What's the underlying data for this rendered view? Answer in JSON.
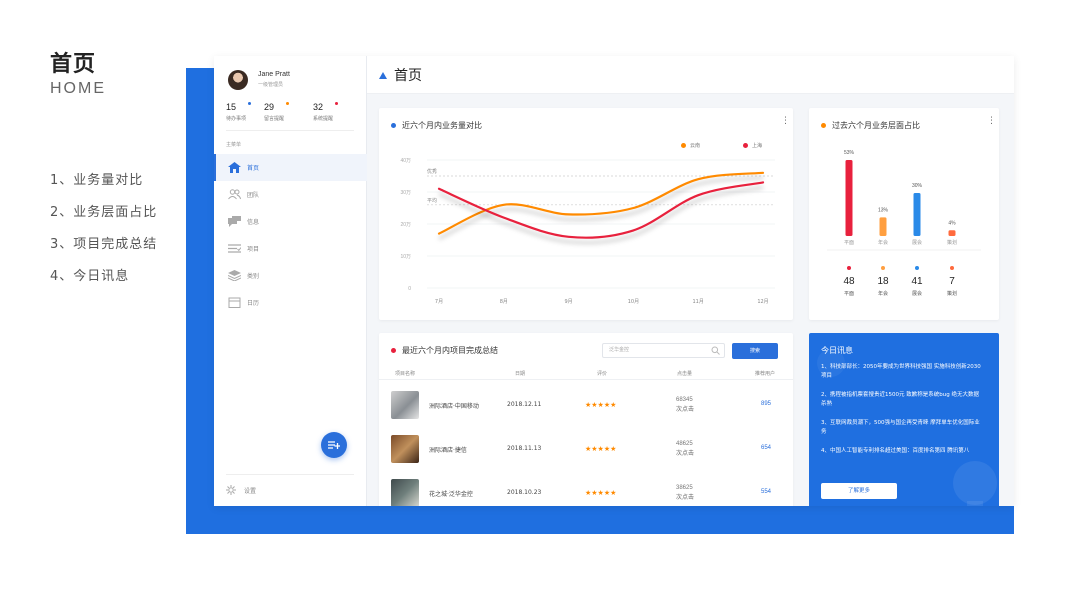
{
  "slide": {
    "title": "首页",
    "subtitle": "HOME",
    "outline": [
      "1、业务量对比",
      "2、业务层面占比",
      "3、项目完成总结",
      "4、今日讯息"
    ]
  },
  "user": {
    "name": "Jane Pratt",
    "role": "一级管理员"
  },
  "stats": [
    {
      "value": "15",
      "label": "待办事项",
      "color": "#2a6fdb"
    },
    {
      "value": "29",
      "label": "留言提醒",
      "color": "#ff8a00"
    },
    {
      "value": "32",
      "label": "系统提醒",
      "color": "#e8213d"
    }
  ],
  "menu": {
    "heading": "主菜单",
    "items": [
      {
        "label": "首页",
        "icon": "home-icon",
        "active": true
      },
      {
        "label": "团队",
        "icon": "team-icon"
      },
      {
        "label": "信息",
        "icon": "message-icon"
      },
      {
        "label": "项目",
        "icon": "project-icon"
      },
      {
        "label": "类别",
        "icon": "layers-icon"
      },
      {
        "label": "日历",
        "icon": "calendar-icon"
      }
    ],
    "settings_label": "设置"
  },
  "topbar": {
    "title": "首页"
  },
  "line_card": {
    "title": "近六个月内业务量对比",
    "legend": [
      "云南",
      "上海"
    ]
  },
  "bar_card": {
    "title": "过去六个月业务层面占比"
  },
  "table_card": {
    "title": "最近六个月内项目完成总结",
    "search_placeholder": "泛华金控",
    "search_button": "搜索",
    "headers": [
      "项目名称",
      "日期",
      "评价",
      "点击量",
      "推荐用户"
    ],
    "rows": [
      {
        "name": "洲际酒店·中国移动",
        "date": "2018.12.11",
        "stars": "★★★★★",
        "clicks": "68345",
        "clicks_label": "次点击",
        "users": "895"
      },
      {
        "name": "洲际酒店·捷信",
        "date": "2018.11.13",
        "stars": "★★★★★",
        "clicks": "48625",
        "clicks_label": "次点击",
        "users": "654"
      },
      {
        "name": "花之城·泛华金控",
        "date": "2018.10.23",
        "stars": "★★★★★",
        "clicks": "38625",
        "clicks_label": "次点击",
        "users": "554"
      }
    ]
  },
  "news": {
    "title": "今日讯息",
    "items": [
      "1、科技部部长：2050年要成为世界科技强国 实施科技创新2030项目",
      "2、携程被指机票套搜贵近1500元 致歉称是系统bug 绝无大数据杀熟",
      "3、互联网裁员潮下，500强与国企再受青睐 摩拜单车优化国际业务",
      "4、中国人工智能专利排名超过美国：百度排名第四 腾讯第八"
    ],
    "button": "了解更多"
  },
  "colors": {
    "blue": "#2a6fdb",
    "orange": "#ff8a00",
    "red": "#e8213d"
  },
  "chart_data": [
    {
      "type": "line",
      "title": "近六个月内业务量对比",
      "x": [
        "7月",
        "8月",
        "9月",
        "10月",
        "11月",
        "12月"
      ],
      "ylim": [
        0,
        40
      ],
      "yticks": [
        "0",
        "10万",
        "20万",
        "30万",
        "40万"
      ],
      "reference_lines": [
        {
          "label": "优秀",
          "value": 35
        },
        {
          "label": "平均",
          "value": 26
        }
      ],
      "series": [
        {
          "name": "云南",
          "color": "#ff8a00",
          "values": [
            17,
            26,
            23,
            25,
            34,
            36
          ]
        },
        {
          "name": "上海",
          "color": "#e8213d",
          "values": [
            31,
            22,
            16,
            18,
            29,
            33
          ]
        }
      ],
      "grid": true,
      "legend": "top-right"
    },
    {
      "type": "bar",
      "title": "过去六个月业务层面占比",
      "categories": [
        "平面",
        "年会",
        "展会",
        "策划"
      ],
      "values": [
        53,
        13,
        30,
        4
      ],
      "value_labels": [
        "53%",
        "13%",
        "30%",
        "4%"
      ],
      "colors": [
        "#e8213d",
        "#ff9f40",
        "#2a8ae8",
        "#ff6a3d"
      ],
      "counts": [
        "48",
        "18",
        "41",
        "7"
      ]
    }
  ]
}
